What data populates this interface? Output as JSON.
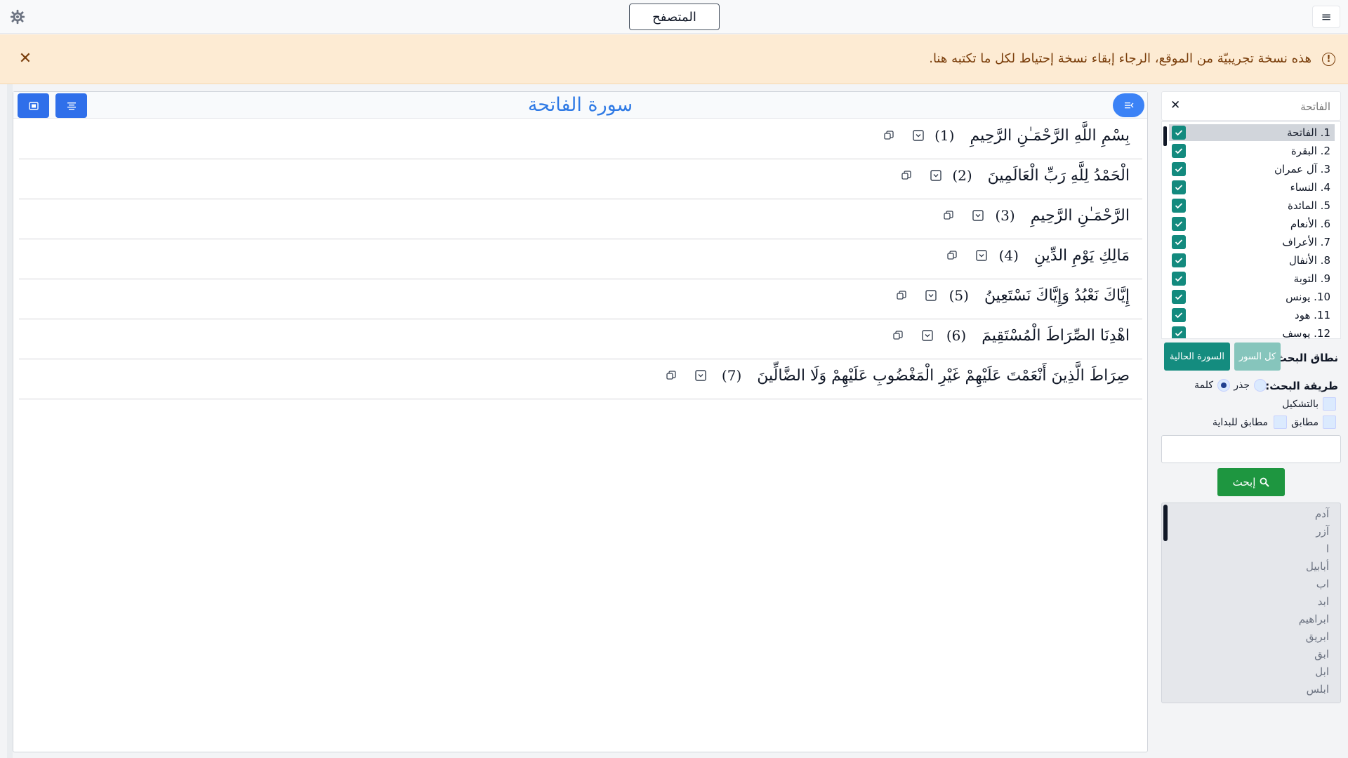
{
  "topbar": {
    "app_title": "المتصفح",
    "settings_icon": "gear-icon",
    "menu_icon": "hamburger-icon",
    "menu_glyph": "≡"
  },
  "alert": {
    "message": "هذه نسخة تجريبيّة من الموقع، الرجاء إبقاء نسخة إحتياط لكل ما تكتبه هنا.",
    "info_glyph": "!",
    "close_glyph": "✕",
    "bg_color": "#fdebd3",
    "text_color": "#7a3e0b"
  },
  "reader": {
    "surah_title": "سورة الفاتحة",
    "title_color": "#2f7ae5",
    "ayahs": [
      {
        "text": "بِسْمِ اللَّهِ الرَّحْمَـٰنِ الرَّحِيمِ",
        "num": "(1)"
      },
      {
        "text": "الْحَمْدُ لِلَّهِ رَبِّ الْعَالَمِينَ",
        "num": "(2)"
      },
      {
        "text": "الرَّحْمَـٰنِ الرَّحِيمِ",
        "num": "(3)"
      },
      {
        "text": "مَالِكِ يَوْمِ الدِّينِ",
        "num": "(4)"
      },
      {
        "text": "إِيَّاكَ نَعْبُدُ وَإِيَّاكَ نَسْتَعِينُ",
        "num": "(5)"
      },
      {
        "text": "اهْدِنَا الصِّرَاطَ الْمُسْتَقِيمَ",
        "num": "(6)"
      },
      {
        "text": "صِرَاطَ الَّذِينَ أَنْعَمْتَ عَلَيْهِمْ غَيْرِ الْمَغْضُوبِ عَلَيْهِمْ وَلَا الضَّالِّينَ",
        "num": "(7)"
      }
    ]
  },
  "sidebar": {
    "surah_filter": {
      "value": "",
      "placeholder": "الفاتحة",
      "clear_glyph": "✕"
    },
    "surahs": [
      {
        "label": "1. الفاتحة",
        "checked": true,
        "active": true
      },
      {
        "label": "2. البقرة",
        "checked": true
      },
      {
        "label": "3. آل عمران",
        "checked": true
      },
      {
        "label": "4. النساء",
        "checked": true
      },
      {
        "label": "5. المائدة",
        "checked": true
      },
      {
        "label": "6. الأنعام",
        "checked": true
      },
      {
        "label": "7. الأعراف",
        "checked": true
      },
      {
        "label": "8. الأنفال",
        "checked": true
      },
      {
        "label": "9. التوبة",
        "checked": true
      },
      {
        "label": "10. يونس",
        "checked": true
      },
      {
        "label": "11. هود",
        "checked": true
      },
      {
        "label": "12. يوسف",
        "checked": true
      }
    ],
    "scope": {
      "label": "نطاق البحث:",
      "all_surahs": "كل السور",
      "current_surah": "السورة الحالية"
    },
    "method": {
      "label": "طريقة البحث:",
      "root": "جذر",
      "word": "كلمة",
      "selected": "word"
    },
    "options": {
      "with_diacritics": "بالتشكيل",
      "exact": "مطابق",
      "starts_with": "مطابق للبداية"
    },
    "query": {
      "value": "",
      "placeholder": ""
    },
    "search_button": "إبحث",
    "roots": [
      "آدم",
      "آزر",
      "ا",
      "أبابيل",
      "اب",
      "ابد",
      "ابراهيم",
      "ابريق",
      "ابق",
      "ابل",
      "ابلس"
    ]
  }
}
